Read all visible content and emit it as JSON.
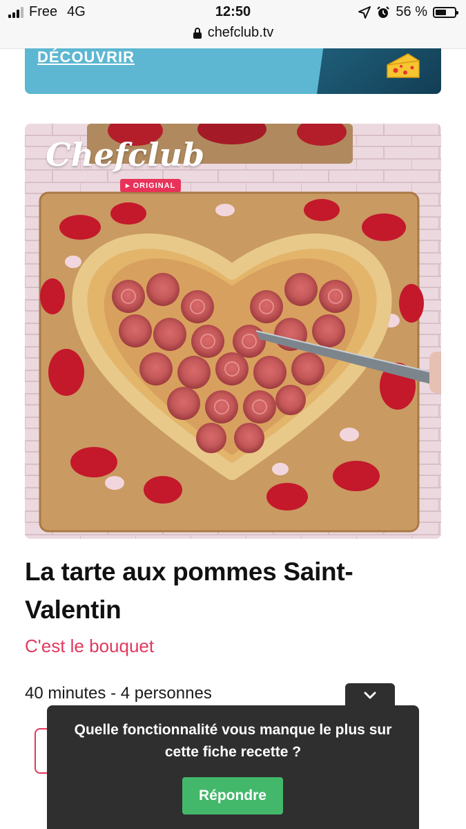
{
  "status_bar": {
    "carrier": "Free",
    "network": "4G",
    "time": "12:50",
    "url": "chefclub.tv",
    "battery_percent": "56 %",
    "battery_level": 0.56
  },
  "banner": {
    "cta_label": "DÉCOUVRIR"
  },
  "hero": {
    "logo_text": "Chefclub",
    "logo_badge": "▸ ORIGINAL"
  },
  "recipe": {
    "title": "La tarte aux pommes Saint-Valentin",
    "subtitle": "C'est le bouquet",
    "meta": "40 minutes - 4 personnes"
  },
  "survey": {
    "question": "Quelle fonctionnalité vous manque le plus sur cette fiche recette ?",
    "button_label": "Répondre"
  },
  "colors": {
    "accent_pink": "#e2385d",
    "banner_blue": "#5db7d2",
    "popup_dark": "#2f2f2f",
    "button_green": "#43b86b"
  }
}
